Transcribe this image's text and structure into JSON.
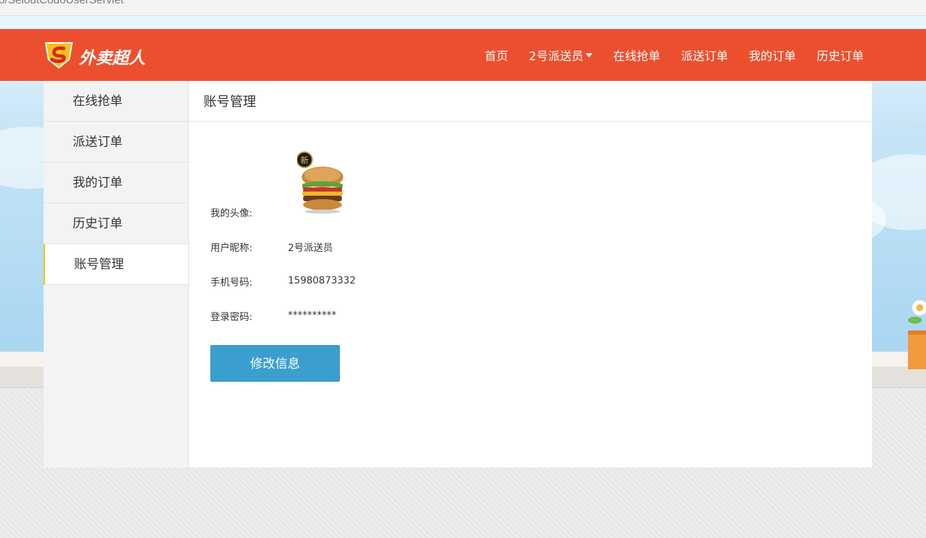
{
  "browser": {
    "address_text": "o/SeloutCodoUserServlet"
  },
  "header": {
    "brand": "外卖超人",
    "nav": [
      {
        "label": "首页"
      },
      {
        "label": "2号派送员",
        "has_dropdown": true
      },
      {
        "label": "在线抢单"
      },
      {
        "label": "派送订单"
      },
      {
        "label": "我的订单"
      },
      {
        "label": "历史订单"
      }
    ]
  },
  "sidebar": {
    "items": [
      {
        "label": "在线抢单"
      },
      {
        "label": "派送订单"
      },
      {
        "label": "我的订单"
      },
      {
        "label": "历史订单"
      },
      {
        "label": "账号管理",
        "active": true
      }
    ]
  },
  "content": {
    "title": "账号管理",
    "avatar_label": "我的头像:",
    "avatar_badge": "新",
    "fields": [
      {
        "label": "用户昵称:",
        "value": "2号派送员"
      },
      {
        "label": "手机号码:",
        "value": "15980873332"
      },
      {
        "label": "登录密码:",
        "value": "**********"
      }
    ],
    "edit_button": "修改信息"
  },
  "colors": {
    "header_bg": "#ec4f2e",
    "button_bg": "#3a9fcf",
    "active_marker": "#f5c400"
  }
}
